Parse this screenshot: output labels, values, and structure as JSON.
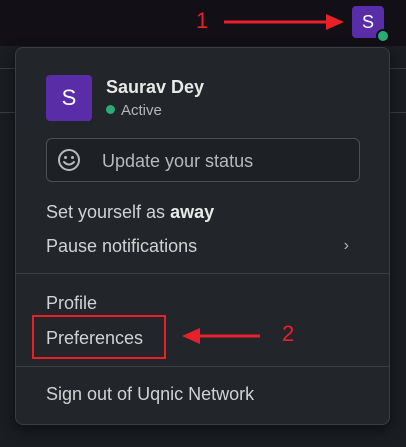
{
  "annotations": {
    "step1": "1",
    "step2": "2",
    "color": "#e8202a"
  },
  "top_avatar": {
    "initial": "S"
  },
  "menu": {
    "user": {
      "initial": "S",
      "name": "Saurav Dey",
      "status": "Active"
    },
    "status_input": {
      "icon": "smiley-icon",
      "placeholder": "Update your status"
    },
    "away": {
      "prefix": "Set yourself as ",
      "bold": "away"
    },
    "pause": {
      "label": "Pause notifications",
      "chevron": "›"
    },
    "profile": "Profile",
    "preferences": "Preferences",
    "sign_out": "Sign out of Uqnic Network"
  },
  "colors": {
    "avatar": "#5a2da8",
    "presence": "#2bac76",
    "menu_bg": "#222529"
  }
}
